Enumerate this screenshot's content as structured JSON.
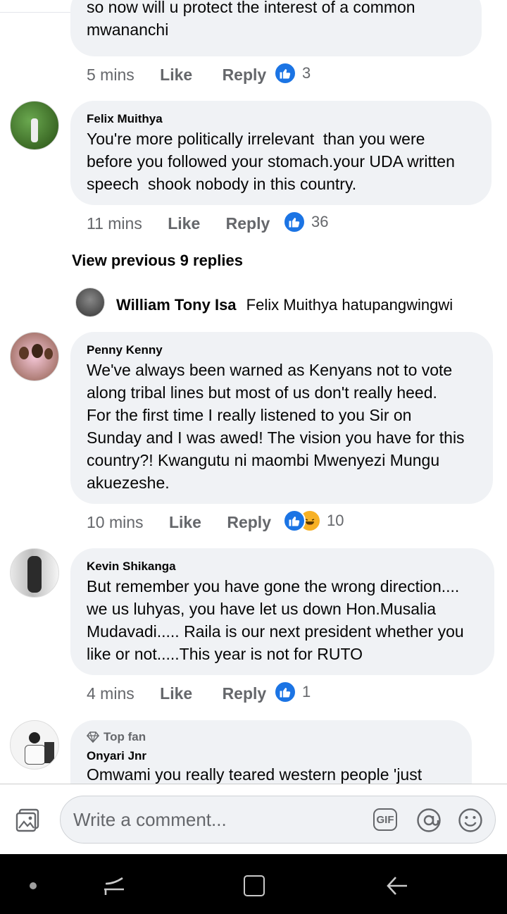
{
  "comments": [
    {
      "name": "",
      "text": "so now will u protect the interest of a common\nmwananchi",
      "time": "5 mins",
      "like": "Like",
      "reply": "Reply",
      "reactions": "3"
    },
    {
      "name": "Felix Muithya",
      "text": "You're more politically irrelevant  than you were\nbefore you followed your stomach.your UDA written\nspeech  shook nobody in this country.",
      "time": "11 mins",
      "like": "Like",
      "reply": "Reply",
      "reactions": "36"
    },
    {
      "name": "Penny Kenny",
      "text": "We've always been warned as Kenyans not to vote\nalong tribal lines but most of us don't really heed.\nFor the first time I really listened to you Sir on\nSunday and I was awed! The vision you have for this\ncountry?! Kwangutu ni maombi Mwenyezi Mungu\nakuezeshe.",
      "time": "10 mins",
      "like": "Like",
      "reply": "Reply",
      "reactions": "10"
    },
    {
      "name": "Kevin Shikanga",
      "text": "But remember you have gone the wrong direction....\nwe us luhyas, you have let us down Hon.Musalia\nMudavadi..... Raila is our next president whether you\nlike or not.....This year is not for RUTO",
      "time": "4 mins",
      "like": "Like",
      "reply": "Reply",
      "reactions": "1"
    },
    {
      "badge": "Top fan",
      "name": "Onyari Jnr",
      "text": "Omwami you really teared western people 'just"
    }
  ],
  "view_previous": "View previous 9 replies",
  "reply_preview": {
    "name": "William Tony Isa",
    "text": "Felix Muithya hatupangwingwi"
  },
  "composer": {
    "placeholder": "Write a comment...",
    "gif": "GIF"
  },
  "colors": {
    "bubble": "#f0f2f5",
    "like_blue": "#1b74e4",
    "haha_yellow": "#f7b125",
    "meta_gray": "#65676b"
  },
  "icons": {
    "thumb": "thumbs-up-icon",
    "haha": "haha-icon",
    "photo": "photo-icon",
    "gif": "gif-icon",
    "mention": "at-icon",
    "emoji": "smiley-icon"
  }
}
